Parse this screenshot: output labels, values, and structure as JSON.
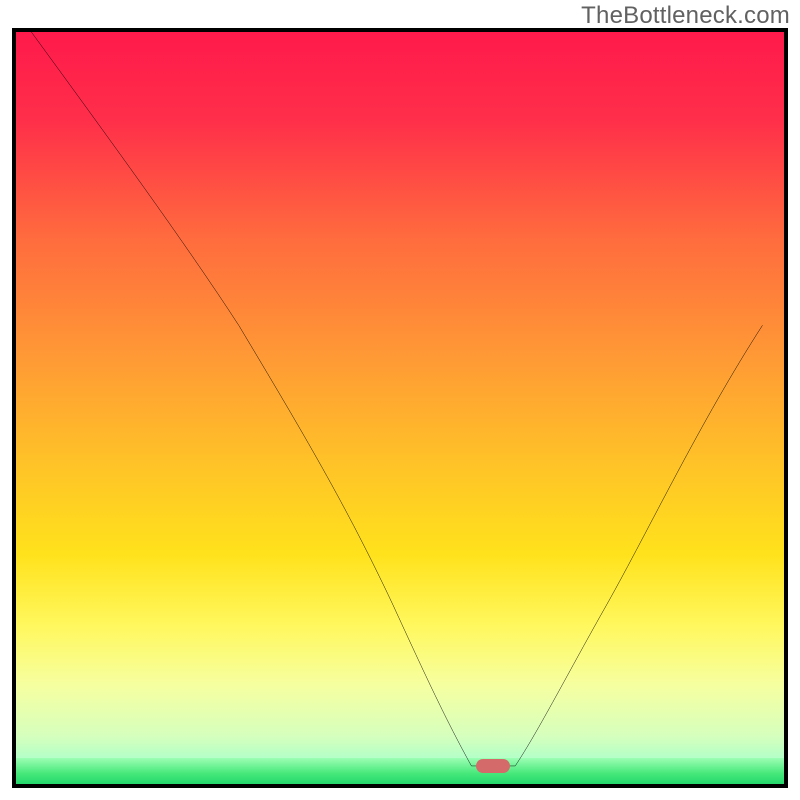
{
  "watermark": "TheBottleneck.com",
  "chart_data": {
    "type": "line",
    "title": "",
    "xlabel": "",
    "ylabel": "",
    "xlim": [
      0,
      100
    ],
    "ylim": [
      0,
      100
    ],
    "note": "Axes have no tick labels in the image; coordinates below are in percent of the plot box (0,0 = top-left, 100,100 = bottom-right) estimated from pixels.",
    "series": [
      {
        "name": "bottleneck-curve",
        "x": [
          2,
          12,
          22,
          29,
          38,
          43,
          49,
          54,
          56,
          59.3,
          65,
          68,
          72,
          77,
          82,
          89,
          97.2
        ],
        "y": [
          0,
          14,
          28,
          39,
          54,
          63,
          76,
          86,
          92,
          97.6,
          97.6,
          93,
          85,
          76,
          66,
          52,
          39
        ]
      }
    ],
    "marker": {
      "name": "bottleneck",
      "x": 62.1,
      "y": 97.6,
      "color": "#d46a6a"
    },
    "background_gradient_top_to_bottom": [
      "#ff1a4b",
      "#ff6a3e",
      "#ffc427",
      "#fff85f",
      "#d6ffbd",
      "#24d86c"
    ],
    "green_band_from_y_percent": 96.5
  }
}
